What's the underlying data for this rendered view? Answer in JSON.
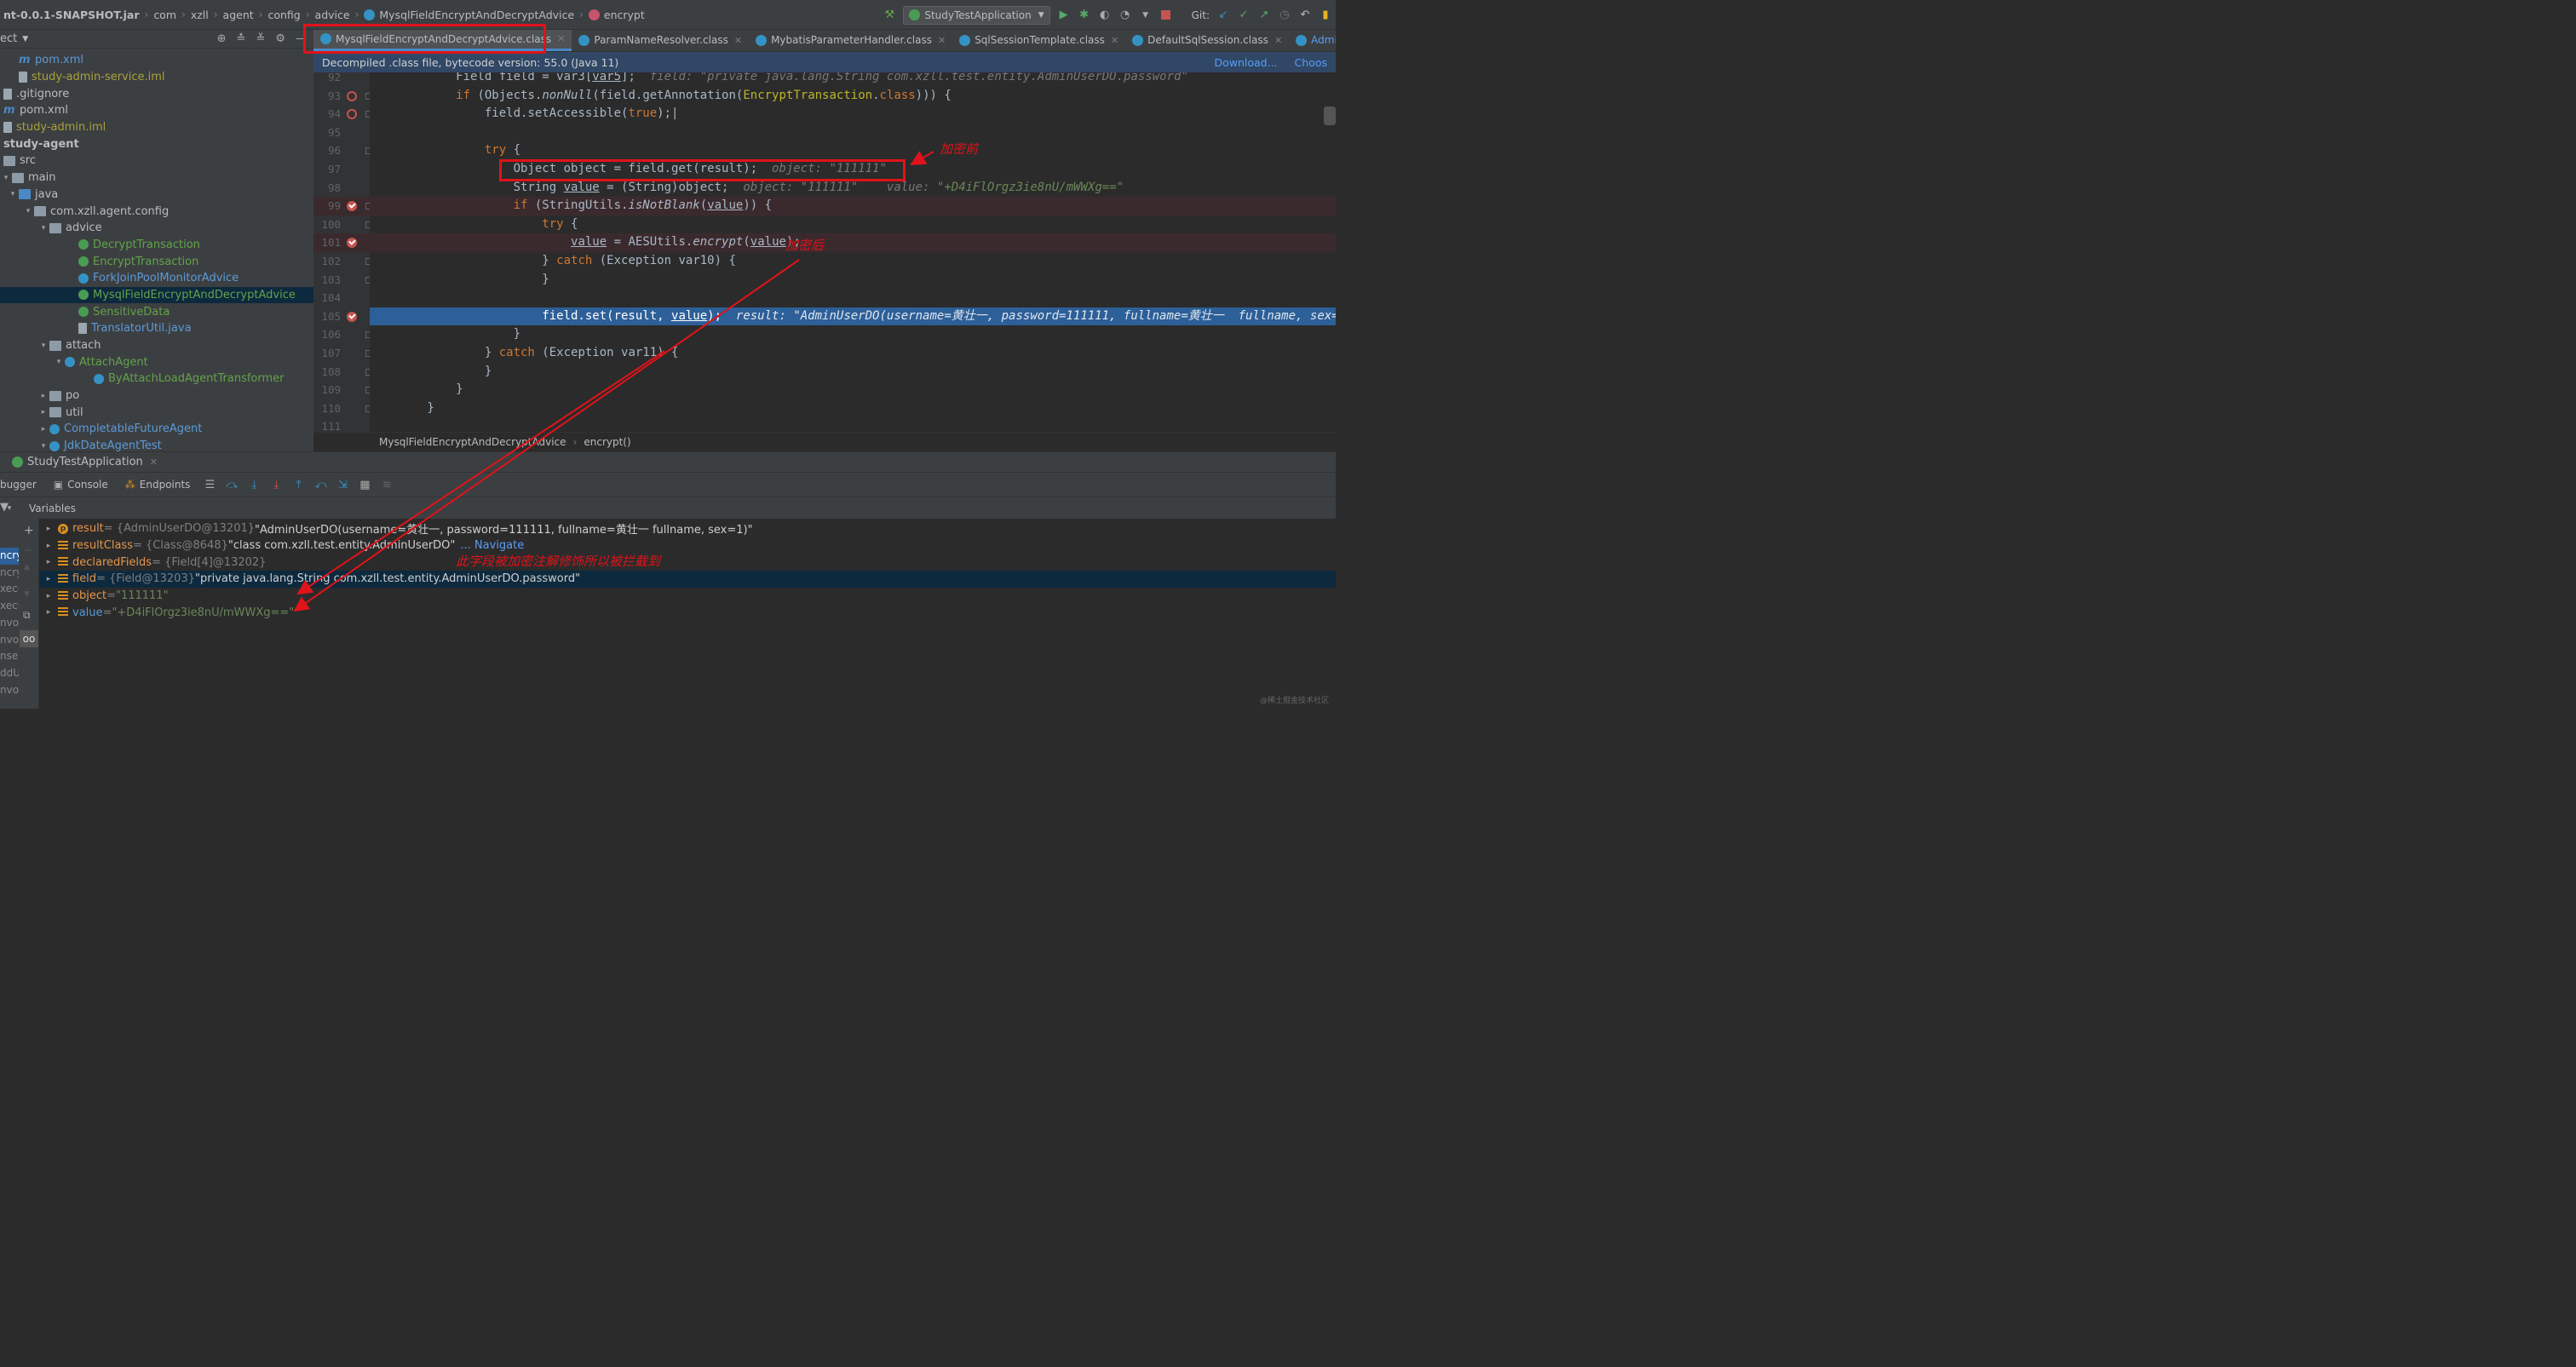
{
  "breadcrumb": [
    "nt-0.0.1-SNAPSHOT.jar",
    "com",
    "xzll",
    "agent",
    "config",
    "advice",
    "MysqlFieldEncryptAndDecryptAdvice",
    "encrypt"
  ],
  "toolbar": {
    "run_config": "StudyTestApplication",
    "git_label": "Git:"
  },
  "project": {
    "header": "ect",
    "items": [
      {
        "label": "pom.xml",
        "indent": 22,
        "icon": "m",
        "color": "blu"
      },
      {
        "label": "study-admin-service.iml",
        "indent": 22,
        "icon": "file",
        "color": "yel"
      },
      {
        "label": ".gitignore",
        "indent": 4,
        "icon": "file",
        "color": ""
      },
      {
        "label": "pom.xml",
        "indent": 4,
        "icon": "m",
        "color": ""
      },
      {
        "label": "study-admin.iml",
        "indent": 4,
        "icon": "file",
        "color": "yel"
      },
      {
        "label": "study-agent",
        "indent": 4,
        "icon": "none",
        "color": "",
        "bold": true
      },
      {
        "label": "src",
        "indent": 4,
        "icon": "folder",
        "color": ""
      },
      {
        "label": "main",
        "indent": 4,
        "icon": "folder",
        "color": "",
        "arrow": "▾"
      },
      {
        "label": "java",
        "indent": 22,
        "icon": "folderblue",
        "color": "",
        "arrow": "▾"
      },
      {
        "label": "com.xzll.agent.config",
        "indent": 40,
        "icon": "folder",
        "color": "",
        "arrow": "▾"
      },
      {
        "label": "advice",
        "indent": 58,
        "icon": "folder",
        "color": "",
        "arrow": "▾"
      },
      {
        "label": "DecryptTransaction",
        "indent": 92,
        "icon": "g",
        "color": "grn"
      },
      {
        "label": "EncryptTransaction",
        "indent": 92,
        "icon": "g",
        "color": "grn"
      },
      {
        "label": "ForkJoinPoolMonitorAdvice",
        "indent": 92,
        "icon": "b",
        "color": "blu"
      },
      {
        "label": "MysqlFieldEncryptAndDecryptAdvice",
        "indent": 92,
        "icon": "g",
        "color": "grn",
        "selected": true
      },
      {
        "label": "SensitiveData",
        "indent": 92,
        "icon": "g",
        "color": "grn"
      },
      {
        "label": "TranslatorUtil.java",
        "indent": 92,
        "icon": "file",
        "color": "blu"
      },
      {
        "label": "attach",
        "indent": 58,
        "icon": "folder",
        "color": "",
        "arrow": "▾"
      },
      {
        "label": "AttachAgent",
        "indent": 76,
        "icon": "b",
        "color": "grn",
        "arrow": "▾"
      },
      {
        "label": "ByAttachLoadAgentTransformer",
        "indent": 110,
        "icon": "b",
        "color": "grn"
      },
      {
        "label": "po",
        "indent": 58,
        "icon": "folder",
        "color": "",
        "arrow": "▸"
      },
      {
        "label": "util",
        "indent": 58,
        "icon": "folder",
        "color": "",
        "arrow": "▸"
      },
      {
        "label": "CompletableFutureAgent",
        "indent": 58,
        "icon": "b",
        "color": "blu",
        "arrow": "▸"
      },
      {
        "label": "JdkDateAgentTest",
        "indent": 58,
        "icon": "b",
        "color": "blu",
        "arrow": "▾"
      }
    ]
  },
  "editor": {
    "tabs": [
      {
        "label": "MysqlFieldEncryptAndDecryptAdvice.class",
        "active": true
      },
      {
        "label": "ParamNameResolver.class"
      },
      {
        "label": "MybatisParameterHandler.class"
      },
      {
        "label": "SqlSessionTemplate.class"
      },
      {
        "label": "DefaultSqlSession.class"
      },
      {
        "label": "AdminUserDO.java"
      },
      {
        "label": "AdminU"
      }
    ],
    "notice": "Decompiled .class file, bytecode version: 55.0 (Java 11)",
    "notice_links": [
      "Download...",
      "Choos"
    ],
    "line_numbers": [
      "92",
      "93",
      "94",
      "95",
      "96",
      "97",
      "98",
      "99",
      "100",
      "101",
      "102",
      "103",
      "104",
      "105",
      "106",
      "107",
      "108",
      "109",
      "110",
      "111"
    ],
    "breadcrumb": [
      "MysqlFieldEncryptAndDecryptAdvice",
      "encrypt()"
    ]
  },
  "code_lines": [
    [
      {
        "t": "            Field field = var3["
      },
      {
        "t": "var5",
        "c": "u"
      },
      {
        "t": "];  "
      },
      {
        "t": "field: \"private java.lang.String com.xzll.test.entity.AdminUserDO.password\"",
        "c": "inl"
      }
    ],
    [
      {
        "t": "            "
      },
      {
        "t": "if",
        "c": "kw"
      },
      {
        "t": " (Objects."
      },
      {
        "t": "nonNull",
        "c": "it"
      },
      {
        "t": "(field.getAnnotation("
      },
      {
        "t": "EncryptTransaction",
        "c": "ann2"
      },
      {
        "t": "."
      },
      {
        "t": "class",
        "c": "kw"
      },
      {
        "t": "))) {"
      }
    ],
    [
      {
        "t": "                field.setAccessible("
      },
      {
        "t": "true",
        "c": "kw"
      },
      {
        "t": ");|"
      }
    ],
    [
      {
        "t": ""
      }
    ],
    [
      {
        "t": "                "
      },
      {
        "t": "try",
        "c": "kw"
      },
      {
        "t": " {"
      }
    ],
    [
      {
        "t": "                    Object object = field.get(result);  "
      },
      {
        "t": "object: \"111111\"",
        "c": "inl"
      }
    ],
    [
      {
        "t": "                    String "
      },
      {
        "t": "value",
        "c": "u"
      },
      {
        "t": " = (String)object;  "
      },
      {
        "t": "object: \"111111\"",
        "c": "inl"
      },
      {
        "t": "    "
      },
      {
        "t": "value: ",
        "c": "inl"
      },
      {
        "t": "\"+D4iFlOrgz3ie8nU/mWWXg==\"",
        "c": "instr"
      }
    ],
    [
      {
        "t": "                    "
      },
      {
        "t": "if",
        "c": "kw"
      },
      {
        "t": " (StringUtils."
      },
      {
        "t": "isNotBlank",
        "c": "it"
      },
      {
        "t": "("
      },
      {
        "t": "value",
        "c": "u"
      },
      {
        "t": ")) {"
      }
    ],
    [
      {
        "t": "                        "
      },
      {
        "t": "try",
        "c": "kw"
      },
      {
        "t": " {"
      }
    ],
    [
      {
        "t": "                            "
      },
      {
        "t": "value",
        "c": "u"
      },
      {
        "t": " = AESUtils."
      },
      {
        "t": "encrypt",
        "c": "it"
      },
      {
        "t": "("
      },
      {
        "t": "value",
        "c": "u"
      },
      {
        "t": ");"
      }
    ],
    [
      {
        "t": "                        } "
      },
      {
        "t": "catch",
        "c": "kw"
      },
      {
        "t": " (Exception var10) {"
      }
    ],
    [
      {
        "t": "                        }"
      }
    ],
    [
      {
        "t": ""
      }
    ],
    [
      {
        "t": "                        field.set(result, "
      },
      {
        "t": "value",
        "c": "u"
      },
      {
        "t": ");  "
      },
      {
        "t": "result: \"AdminUserDO(username=黄壮一, password=111111, fullname=黄壮一  fullname, sex=1)\"",
        "c": "inl"
      }
    ],
    [
      {
        "t": "                    }"
      }
    ],
    [
      {
        "t": "                } "
      },
      {
        "t": "catch",
        "c": "kw"
      },
      {
        "t": " (Exception var11) {"
      }
    ],
    [
      {
        "t": "                }"
      }
    ],
    [
      {
        "t": "            }"
      }
    ],
    [
      {
        "t": "        }"
      }
    ],
    [
      {
        "t": ""
      }
    ]
  ],
  "debug": {
    "run_tab": "StudyTestApplication",
    "tabs": [
      "bugger",
      "Console",
      "Endpoints"
    ],
    "variables_label": "Variables",
    "left_frames": [
      "ncry",
      "ncry",
      "xecu",
      "xecu",
      "nvok",
      "nvok",
      "nser",
      "ddU",
      "nvok"
    ],
    "variables": [
      {
        "name": "result",
        "type": " = {AdminUserDO@13201} ",
        "value": "\"AdminUserDO(username=黄壮一, password=111111, fullname=黄壮一  fullname, sex=1)\"",
        "icon": "p",
        "kind": "val"
      },
      {
        "name": "resultClass",
        "type": " = {Class@8648} ",
        "value": "\"class com.xzll.test.entity.AdminUserDO\"",
        "icon": "lst",
        "kind": "val",
        "nav": "... Navigate"
      },
      {
        "name": "declaredFields",
        "type": " = {Field[4]@13202}",
        "value": "",
        "icon": "lst",
        "kind": "val"
      },
      {
        "name": "field",
        "type": " = {Field@13203} ",
        "value": "\"private java.lang.String com.xzll.test.entity.AdminUserDO.password\"",
        "icon": "lst",
        "kind": "val",
        "selected": true
      },
      {
        "name": "object",
        "type": " = ",
        "value": "\"111111\"",
        "icon": "lst",
        "kind": "str"
      },
      {
        "name": "value",
        "type": " = ",
        "value": "\"+D4iFlOrgz3ie8nU/mWWXg==\"",
        "icon": "lst",
        "kind": "str",
        "blue": true
      }
    ]
  },
  "annotations": {
    "before": "加密前",
    "after": "加密后",
    "note": "此字段被加密注解修饰所以被拦截到",
    "color": "#e0131a"
  },
  "watermark": "@稀土掘金技术社区"
}
